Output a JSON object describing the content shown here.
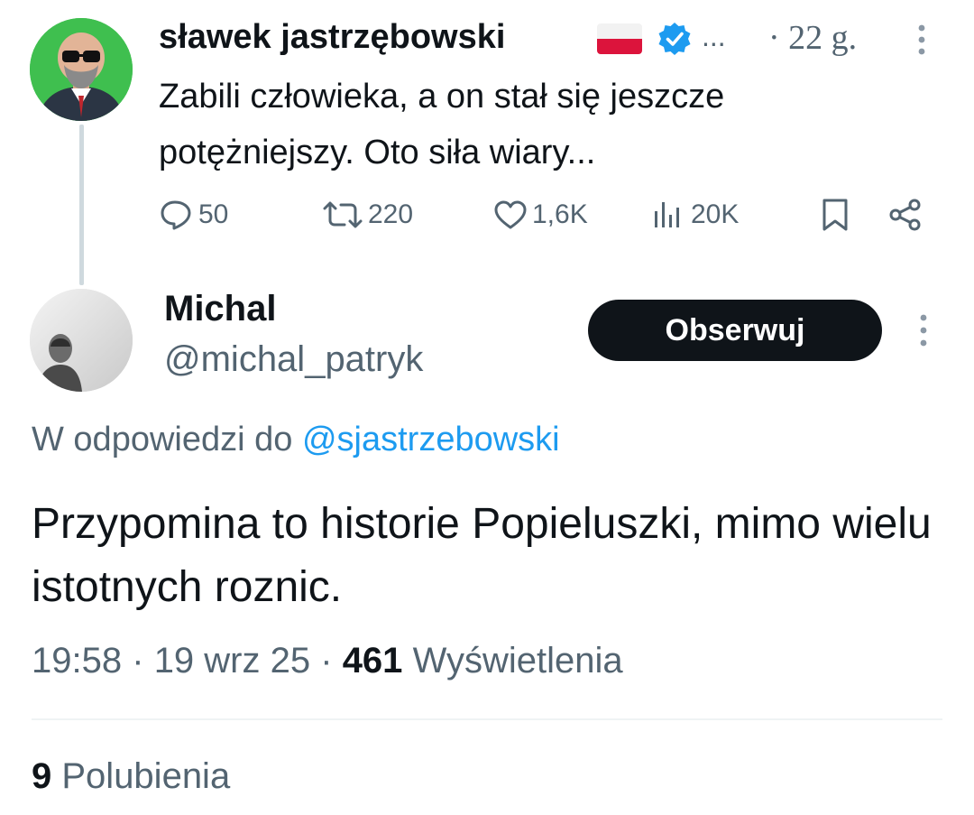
{
  "parent_tweet": {
    "author_name": "sławek jastrzębowski",
    "overflow_ellipsis": "...",
    "time_ago": "· 22 g.",
    "text": "Zabili człowieka, a on stał się jeszcze potężniejszy. Oto siła wiary...",
    "actions": {
      "replies": "50",
      "retweets": "220",
      "likes": "1,6K",
      "views": "20K"
    }
  },
  "reply": {
    "author_name": "Michal",
    "handle": "@michal_patryk",
    "follow_label": "Obserwuj",
    "in_reply_to_prefix": "W odpowiedzi do",
    "in_reply_to_handle": "@sjastrzebowski",
    "text": "Przypomina to historie Popieluszki, mimo wielu istotnych roznic.",
    "time": "19:58",
    "separator_1": "·",
    "date": "19 wrz 25",
    "separator_2": "·",
    "views_count": "461",
    "views_label": "Wyświetlenia",
    "likes_count": "9",
    "likes_label": "Polubienia"
  },
  "icons": {
    "reply": "speech-bubble-icon",
    "retweet": "retweet-icon",
    "like": "heart-icon",
    "views": "bar-chart-icon",
    "bookmark": "bookmark-icon",
    "share": "share-icon",
    "more": "vertical-dots-icon",
    "verified": "verified-badge-icon",
    "flag": "poland-flag-icon"
  },
  "colors": {
    "text_primary": "#0f1419",
    "text_secondary": "#536471",
    "accent": "#1d9bf0",
    "button_bg": "#0f1419",
    "button_text": "#ffffff"
  }
}
